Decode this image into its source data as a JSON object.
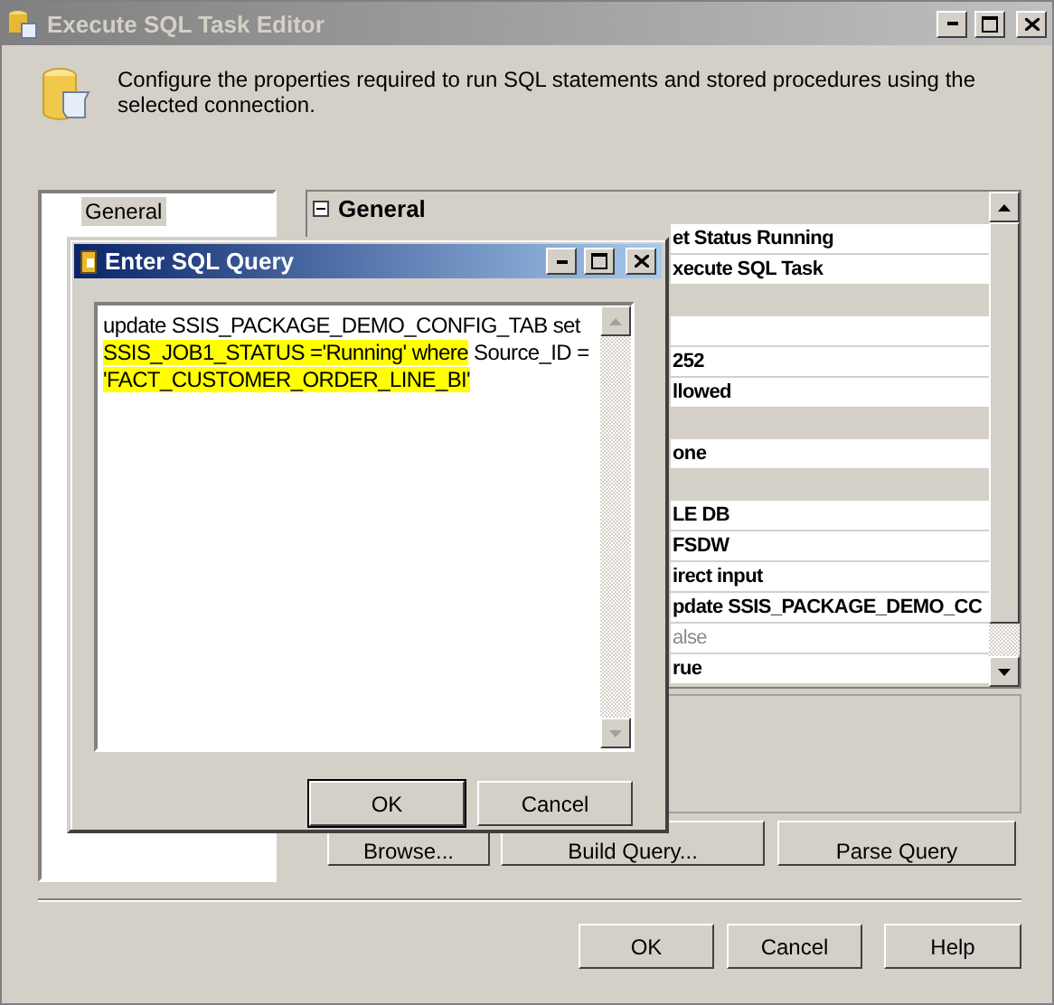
{
  "window": {
    "title": "Execute SQL Task Editor"
  },
  "header": {
    "description": "Configure the properties required to run SQL statements and stored procedures using the selected connection."
  },
  "sidebar": {
    "items": [
      {
        "label": "General",
        "selected": true
      }
    ]
  },
  "property_grid": {
    "section": "General",
    "rows": [
      {
        "kind": "property",
        "value": "et Status Running",
        "disabled": false
      },
      {
        "kind": "property",
        "value": "xecute SQL Task",
        "disabled": false
      },
      {
        "kind": "category"
      },
      {
        "kind": "property"
      },
      {
        "kind": "property",
        "value": "252",
        "disabled": false
      },
      {
        "kind": "property",
        "value": "llowed",
        "disabled": false
      },
      {
        "kind": "category"
      },
      {
        "kind": "property",
        "value": "one",
        "disabled": false
      },
      {
        "kind": "category"
      },
      {
        "kind": "property",
        "value": "LE DB",
        "disabled": false
      },
      {
        "kind": "property",
        "value": "FSDW",
        "disabled": false
      },
      {
        "kind": "property",
        "value": "irect input",
        "disabled": false
      },
      {
        "kind": "property",
        "value": "pdate SSIS_PACKAGE_DEMO_CC",
        "disabled": false
      },
      {
        "kind": "property",
        "value": "alse",
        "disabled": true
      },
      {
        "kind": "property",
        "value": "rue",
        "disabled": false
      }
    ]
  },
  "query_buttons": [
    "Browse...",
    "Build Query...",
    "Parse Query"
  ],
  "buttons": [
    "OK",
    "Cancel",
    "Help"
  ],
  "dialog": {
    "title": "Enter SQL Query",
    "query_lines": [
      [
        {
          "text": "update SSIS_PACKAGE_DEMO_CONFIG_TAB set",
          "highlighted": false
        }
      ],
      [
        {
          "text": "SSIS_JOB1_STATUS ='Running' where",
          "highlighted": true
        },
        {
          "text": " Source_ID =",
          "highlighted": false
        }
      ],
      [
        {
          "text": "'FACT_CUSTOMER_ORDER_LINE_BI'",
          "highlighted": true
        }
      ]
    ],
    "buttons": [
      "OK",
      "Cancel"
    ]
  }
}
